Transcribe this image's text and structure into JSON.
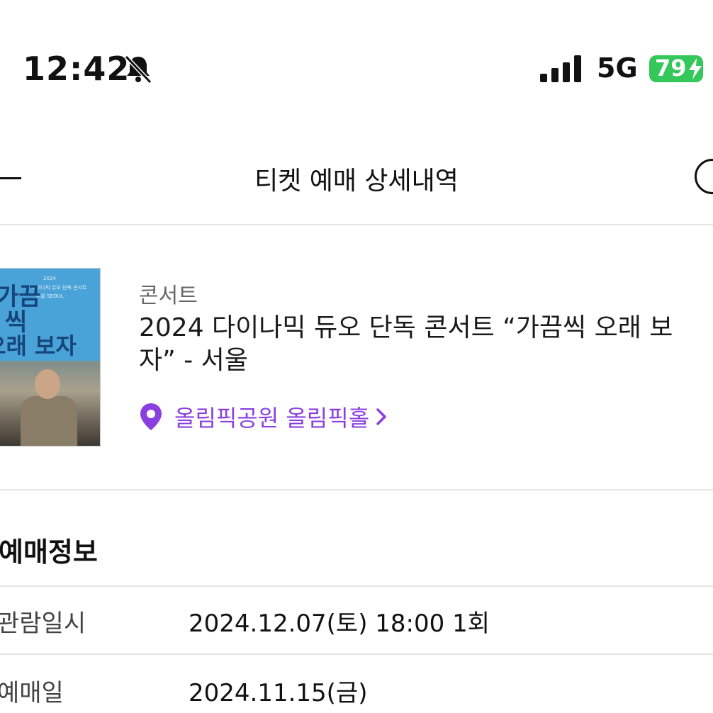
{
  "status_bar": {
    "time": "12:42",
    "network": "5G",
    "battery": "79",
    "battery_color": "#34c759"
  },
  "header": {
    "title": "티켓 예매 상세내역",
    "back_icon": "back-arrow-icon",
    "help_icon": "help-circle-icon"
  },
  "event": {
    "category": "콘서트",
    "title_line1": "2024 다이나믹 듀오 단독 콘서트 “가끔씩 오래 보",
    "title_line2": "자” - 서울",
    "venue": "올림픽공원 올림픽홀",
    "accent_color": "#8b3fe0",
    "poster": {
      "year": "2024",
      "subtitle": "다이나믹 듀오 단독 콘서트",
      "city": "서울 SEOUL",
      "big_line1": "가끔",
      "big_line2": "씩",
      "big_line3": "오래 보자"
    }
  },
  "booking_info": {
    "section_title": "예매정보",
    "rows": [
      {
        "label": "관람일시",
        "value": "2024.12.07(토) 18:00 1회"
      },
      {
        "label": "예매일",
        "value": "2024.11.15(금)"
      }
    ]
  }
}
